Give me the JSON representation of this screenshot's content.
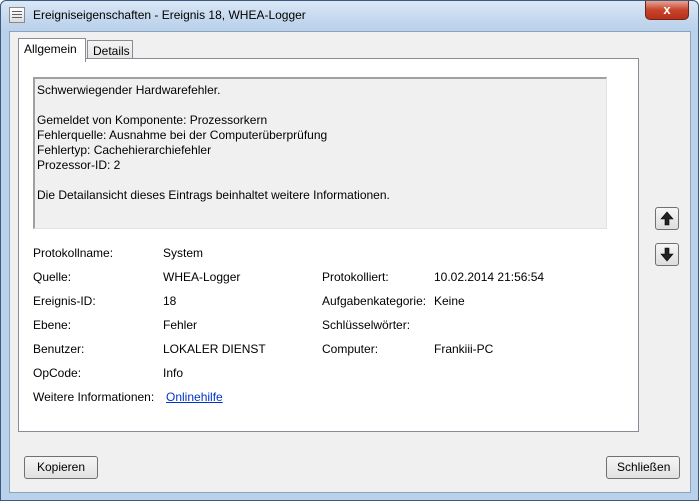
{
  "window": {
    "title": "Ereigniseigenschaften - Ereignis 18, WHEA-Logger",
    "close_label": "x"
  },
  "tabs": [
    {
      "label": "Allgemein",
      "active": true
    },
    {
      "label": "Details",
      "active": false
    }
  ],
  "description": {
    "lines": [
      "Schwerwiegender Hardwarefehler.",
      "",
      "Gemeldet von Komponente: Prozessorkern",
      "Fehlerquelle: Ausnahme bei der Computerüberprüfung",
      "Fehlertyp: Cachehierarchiefehler",
      "Prozessor-ID: 2",
      "",
      "Die Detailansicht dieses Eintrags beinhaltet weitere Informationen."
    ]
  },
  "properties": {
    "protokollname": {
      "label": "Protokollname:",
      "value": "System"
    },
    "quelle": {
      "label": "Quelle:",
      "value": "WHEA-Logger"
    },
    "protokolliert": {
      "label": "Protokolliert:",
      "value": "10.02.2014 21:56:54"
    },
    "ereignis_id": {
      "label": "Ereignis-ID:",
      "value": "18"
    },
    "aufgabenkategorie": {
      "label": "Aufgabenkategorie:",
      "value": "Keine"
    },
    "ebene": {
      "label": "Ebene:",
      "value": "Fehler"
    },
    "schluesselwoerter": {
      "label": "Schlüsselwörter:",
      "value": ""
    },
    "benutzer": {
      "label": "Benutzer:",
      "value": "LOKALER DIENST"
    },
    "computer": {
      "label": "Computer:",
      "value": "Frankiii-PC"
    },
    "opcode": {
      "label": "OpCode:",
      "value": "Info"
    },
    "weitere_informationen": {
      "label": "Weitere Informationen:",
      "value": "Onlinehilfe"
    }
  },
  "buttons": {
    "copy": "Kopieren",
    "close": "Schließen"
  },
  "icons": {
    "up": "arrow-up-icon",
    "down": "arrow-down-icon"
  }
}
